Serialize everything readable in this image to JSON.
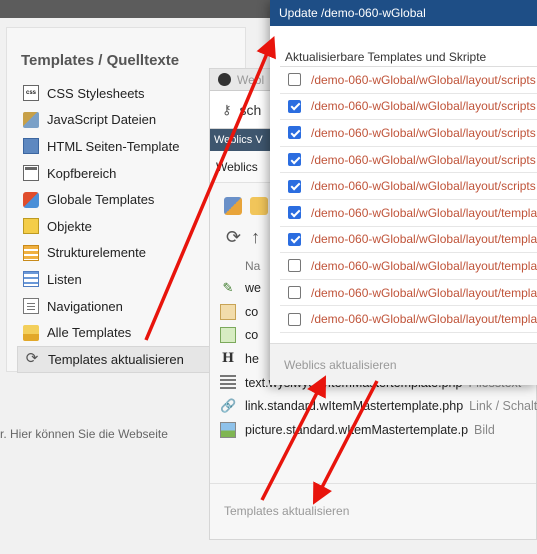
{
  "left_panel": {
    "title": "Templates / Quelltexte",
    "items": [
      {
        "label": "CSS Stylesheets",
        "icon": "css-file-icon",
        "css": "css"
      },
      {
        "label": "JavaScript Dateien",
        "icon": "javascript-file-icon",
        "css": "js"
      },
      {
        "label": "HTML Seiten-Template",
        "icon": "html-template-icon",
        "css": "html"
      },
      {
        "label": "Kopfbereich",
        "icon": "header-icon",
        "css": "header"
      },
      {
        "label": "Globale Templates",
        "icon": "global-templates-icon",
        "css": "global"
      },
      {
        "label": "Objekte",
        "icon": "objects-icon",
        "css": "obj"
      },
      {
        "label": "Strukturelemente",
        "icon": "structure-elements-icon",
        "css": "struct"
      },
      {
        "label": "Listen",
        "icon": "list-icon",
        "css": "list"
      },
      {
        "label": "Navigationen",
        "icon": "navigation-icon",
        "css": "nav"
      },
      {
        "label": "Alle Templates",
        "icon": "all-templates-folder-icon",
        "css": "all"
      },
      {
        "label": "Templates aktualisieren",
        "icon": "refresh-icon",
        "css": "refresh",
        "active": true
      }
    ],
    "bottom_text": "r. Hier können Sie die Webseite"
  },
  "mid_window": {
    "titlebar": "Webl",
    "search_text": "sch",
    "tab_label": "Weblics V",
    "section_label": "Weblics",
    "column_header": "Na",
    "rows": [
      {
        "name": "we",
        "type": "",
        "icon": "edit-pen-icon",
        "css": "edit",
        "glyph": "✎"
      },
      {
        "name": "co",
        "type": "",
        "icon": "template-icon",
        "css": "tpl1",
        "glyph": ""
      },
      {
        "name": "co",
        "type": "",
        "icon": "template-green-icon",
        "css": "tpl2",
        "glyph": ""
      },
      {
        "name": "he",
        "type": "",
        "icon": "heading-icon",
        "css": "hd",
        "glyph": "H"
      },
      {
        "name": "text.wysiwyg.wItemMastertemplate.php",
        "type": "Fliesstext",
        "icon": "text-lines-icon",
        "css": "txt",
        "glyph": ""
      },
      {
        "name": "link.standard.wItemMastertemplate.php",
        "type": "Link / Schaltf",
        "icon": "link-icon",
        "css": "lnk",
        "glyph": "🔗"
      },
      {
        "name": "picture.standard.wItemMastertemplate.p",
        "type": "Bild",
        "icon": "picture-icon",
        "css": "pic",
        "glyph": ""
      }
    ],
    "footer_label": "Templates aktualisieren"
  },
  "dialog": {
    "title": "Update /demo-060-wGlobal",
    "subtitle": "Aktualisierbare Templates und Skripte",
    "rows": [
      {
        "path": "/demo-060-wGlobal/wGlobal/layout/scripts",
        "checked": false
      },
      {
        "path": "/demo-060-wGlobal/wGlobal/layout/scripts",
        "checked": true
      },
      {
        "path": "/demo-060-wGlobal/wGlobal/layout/scripts",
        "checked": true
      },
      {
        "path": "/demo-060-wGlobal/wGlobal/layout/scripts",
        "checked": true
      },
      {
        "path": "/demo-060-wGlobal/wGlobal/layout/scripts",
        "checked": true
      },
      {
        "path": "/demo-060-wGlobal/wGlobal/layout/templa",
        "checked": true
      },
      {
        "path": "/demo-060-wGlobal/wGlobal/layout/templa",
        "checked": true
      },
      {
        "path": "/demo-060-wGlobal/wGlobal/layout/templa",
        "checked": false
      },
      {
        "path": "/demo-060-wGlobal/wGlobal/layout/templa",
        "checked": false
      },
      {
        "path": "/demo-060-wGlobal/wGlobal/layout/templa",
        "checked": false
      }
    ],
    "footer_label": "Weblics aktualisieren"
  },
  "colors": {
    "dialog_title_bg": "#1e4e86",
    "path_text": "#c0543a",
    "checkbox_on": "#2b6de0",
    "annotation_arrow": "#e8140c",
    "mid_tabbar": "#3e566e"
  }
}
